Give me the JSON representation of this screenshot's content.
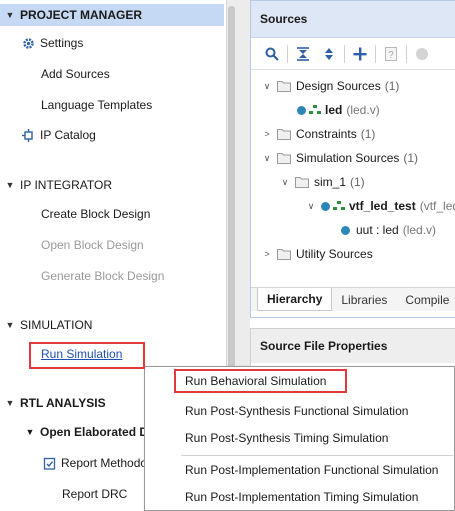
{
  "flow_navigator": {
    "project_manager": {
      "title": "PROJECT MANAGER",
      "items": [
        "Settings",
        "Add Sources",
        "Language Templates",
        "IP Catalog"
      ]
    },
    "ip_integrator": {
      "title": "IP INTEGRATOR",
      "items": [
        "Create Block Design",
        "Open Block Design",
        "Generate Block Design"
      ]
    },
    "simulation": {
      "title": "SIMULATION",
      "items": [
        "Run Simulation"
      ]
    },
    "rtl_analysis": {
      "title": "RTL ANALYSIS",
      "sub_title": "Open Elaborated D",
      "items": [
        "Report Methodo",
        "Report DRC"
      ]
    }
  },
  "sources": {
    "title": "Sources",
    "tree": [
      {
        "label": "Design Sources",
        "count": "(1)"
      },
      {
        "label": "led",
        "file": "(led.v)"
      },
      {
        "label": "Constraints",
        "count": "(1)"
      },
      {
        "label": "Simulation Sources",
        "count": "(1)"
      },
      {
        "label": "sim_1",
        "count": "(1)"
      },
      {
        "label": "vtf_led_test",
        "file": "(vtf_led"
      },
      {
        "label": "uut : led",
        "file": "(led.v)"
      },
      {
        "label": "Utility Sources",
        "count": ""
      }
    ],
    "tabs": [
      "Hierarchy",
      "Libraries",
      "Compile"
    ]
  },
  "source_file_properties": {
    "title": "Source File Properties"
  },
  "context_menu": {
    "items": [
      "Run Behavioral Simulation",
      "Run Post-Synthesis Functional Simulation",
      "Run Post-Synthesis Timing Simulation",
      "Run Post-Implementation Functional Simulation",
      "Run Post-Implementation Timing Simulation"
    ]
  },
  "colors": {
    "highlight_box": "#e23a3a",
    "selected_section": "#c6d9f4",
    "panel_header": "#dde7f5",
    "source_dot": "#2b87b5"
  }
}
